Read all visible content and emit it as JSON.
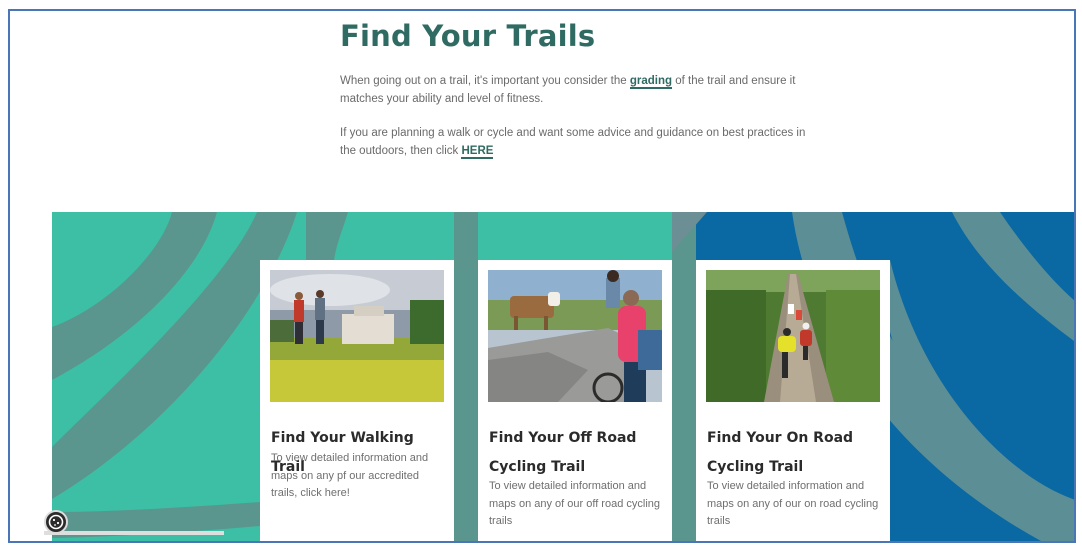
{
  "intro": {
    "title": "Find Your Trails",
    "para1_prefix": "When going out on a trail, it's important you consider the ",
    "para1_link": "grading",
    "para1_suffix": " of the trail and ensure it matches your ability and level of fitness.",
    "para2_prefix": "If you are planning a walk or cycle and want some advice and guidance on best practices in the outdoors, then click ",
    "para2_link": "HERE"
  },
  "cards": [
    {
      "title_line1": "Find Your Walking Trail",
      "title_line2": "",
      "desc": "To view detailed information and maps on any pf our accredited trails, click here!"
    },
    {
      "title_line1": "Find Your Off Road",
      "title_line2": "Cycling Trail",
      "desc": "To view detailed information and maps on any of our off road cycling trails"
    },
    {
      "title_line1": "Find Your On Road",
      "title_line2": "Cycling Trail",
      "desc": "To view detailed information and maps on any of our on road cycling trails"
    }
  ],
  "colors": {
    "brand_green": "#2f6b62",
    "teal_band": "#3dbfa6",
    "blue_band": "#0a68a3",
    "frame_border": "#4a76b7"
  },
  "icons": {
    "cookie": "cookie-icon"
  }
}
